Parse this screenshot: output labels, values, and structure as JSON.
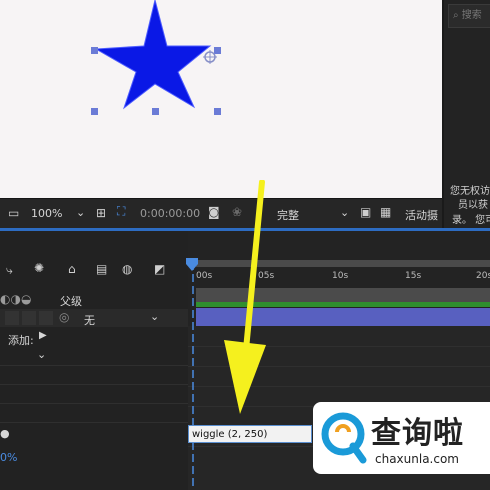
{
  "right_panel": {
    "search_placeholder": "搜索",
    "lines": [
      "您无权访",
      "员以获",
      "录。 您可"
    ]
  },
  "toolbar": {
    "zoom": "100%",
    "timecode": "0:00:00:00",
    "resolution": "完整",
    "active_camera": "活动摄"
  },
  "layer_header": {
    "parent_label": "父级",
    "parent_value": "无",
    "add_label": "添加:",
    "percent": "0%"
  },
  "ruler": {
    "labels": [
      "00s",
      "05s",
      "10s",
      "15s",
      "20s"
    ]
  },
  "expression": {
    "text": "wiggle (2, 250)"
  },
  "watermark": {
    "brand": "查询啦",
    "url": "chaxunla.com"
  },
  "colors": {
    "star": "#0a18e6",
    "selection_handle": "#6b7bd6",
    "layer_bar": "#5860c0",
    "arrow": "#f5f01e",
    "accent": "#2d6cc2"
  }
}
